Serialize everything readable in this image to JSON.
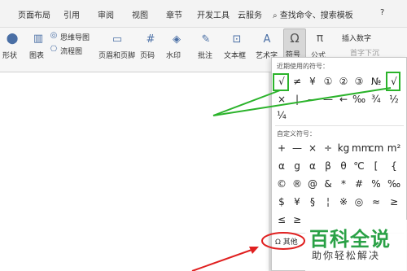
{
  "menu": {
    "tabs": [
      "页面布局",
      "引用",
      "审阅",
      "视图",
      "章节",
      "开发工具",
      "云服务"
    ],
    "search_label": "查找命令、搜索模板",
    "help": "?"
  },
  "toolbar": {
    "shape": "形状",
    "chart": "图表",
    "mindmap": "思维导图",
    "flowchart": "流程图",
    "header_footer": "页眉和页脚",
    "page_num": "页码",
    "watermark": "水印",
    "comment": "批注",
    "textbox": "文本框",
    "wordart": "艺术字",
    "symbol": "符号",
    "formula": "公式",
    "insert_number": "插入数字",
    "first_letter": "首字下沉"
  },
  "symbol_panel": {
    "recent_label": "近期使用的符号：",
    "recent_row1": [
      "√",
      "≠",
      "¥",
      "①",
      "②",
      "③",
      "№",
      "√"
    ],
    "recent_row2": [
      "×",
      "|",
      "—",
      "—",
      "←",
      "‰",
      "¾",
      "½"
    ],
    "recent_row3": [
      "¼"
    ],
    "custom_label": "自定义符号：",
    "custom_rows": [
      [
        "+",
        "—",
        "×",
        "÷",
        "kg",
        "mm",
        "cm",
        "m²"
      ],
      [
        "α",
        "g",
        "α",
        "β",
        "θ",
        "℃",
        "[",
        "{"
      ],
      [
        "©",
        "®",
        "@",
        "&",
        "*",
        "#",
        "%",
        "‰"
      ],
      [
        "$",
        "¥",
        "§",
        "¦",
        "※",
        "◎",
        "≈",
        "≥"
      ],
      [
        "≤",
        "≥"
      ]
    ],
    "more_symbols": "其他"
  },
  "watermark": {
    "title": "百科全说",
    "subtitle": "助你轻松解决"
  },
  "colors": {
    "highlight": "#2bb32b",
    "arrow_red": "#e02020",
    "brand_green": "#2aa146"
  }
}
